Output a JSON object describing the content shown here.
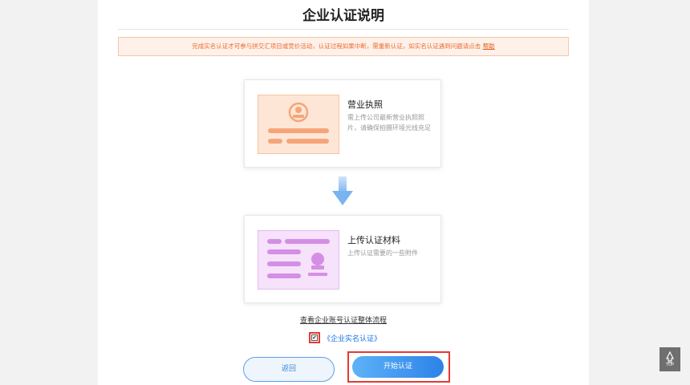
{
  "page": {
    "title": "企业认证说明",
    "notice": {
      "text": "完成实名认证才可参与拼交汇项目或竞价活动，认证过程如果中断，需重新认证，如实名认证遇到问题请点击",
      "help_link": "帮助"
    }
  },
  "steps": [
    {
      "title": "营业执照",
      "description": "需上传公司最新营业执照照片，请确保拍摄环境光线充足",
      "icon": "business-license-icon",
      "accent": "#f8a77a"
    },
    {
      "title": "上传认证材料",
      "description": "上传认证需要的一些附件",
      "icon": "id-card-icon",
      "accent": "#d69ae8"
    }
  ],
  "flow_link": "查看企业账号认证整体流程",
  "agreement": {
    "checked": true,
    "link": "《企业实名认证》"
  },
  "buttons": {
    "back": "返回",
    "start": "开始认证"
  },
  "top_button": {
    "label": "TOP"
  },
  "colors": {
    "primary": "#2c83e8",
    "warning": "#f06b2f",
    "highlight_frame": "#e53935"
  }
}
